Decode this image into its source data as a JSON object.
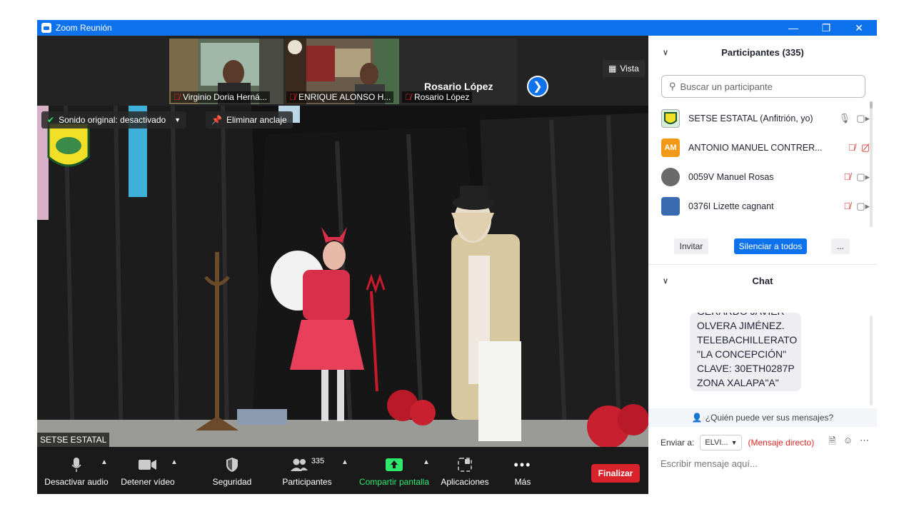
{
  "window": {
    "title": "Zoom Reunión"
  },
  "gallery": {
    "tiles": [
      {
        "name": "Virginio Doria Herná..."
      },
      {
        "name": "ENRIQUE ALONSO H..."
      },
      {
        "name": "Rosario López"
      }
    ],
    "active_speaker": "Rosario López",
    "view_label": "Vista"
  },
  "video": {
    "original_sound": "Sonido original: desactivado",
    "unpin": "Eliminar anclaje",
    "speaker_label": "SETSE ESTATAL"
  },
  "toolbar": {
    "mute": "Desactivar audio",
    "video": "Detener vídeo",
    "security": "Seguridad",
    "participants": "Participantes",
    "participants_count": "335",
    "share": "Compartir pantalla",
    "apps": "Aplicaciones",
    "more": "Más",
    "end": "Finalizar",
    "share_color": "#2ee86d",
    "end_color": "#d8232a"
  },
  "participants_panel": {
    "title": "Participantes (335)",
    "search_placeholder": "Buscar un participante",
    "rows": [
      {
        "name": "SETSE ESTATAL (Anfitrión, yo)",
        "mic": "on",
        "cam": "on"
      },
      {
        "initials": "AM",
        "name": "ANTONIO MANUEL CONTRER...",
        "mic": "off",
        "cam": "off"
      },
      {
        "name": "0059V Manuel Rosas",
        "mic": "off",
        "cam": "on"
      },
      {
        "name": "0376I Lizette cagnant",
        "mic": "off",
        "cam": "on"
      }
    ],
    "invite": "Invitar",
    "mute_all": "Silenciar a todos",
    "more": "..."
  },
  "chat": {
    "title": "Chat",
    "message_lines": [
      "GERARDO JAVIER",
      "OLVERA JIMÉNEZ.",
      "TELEBACHILLERATO",
      "\"LA CONCEPCIÓN\"",
      "CLAVE: 30ETH0287P",
      "ZONA XALAPA\"A\""
    ],
    "who_can_see": "¿Quién puede ver sus mensajes?",
    "send_to_label": "Enviar a:",
    "send_to_value": "ELVI...",
    "direct": "(Mensaje directo)",
    "composer_placeholder": "Escribir mensaje aquí..."
  }
}
